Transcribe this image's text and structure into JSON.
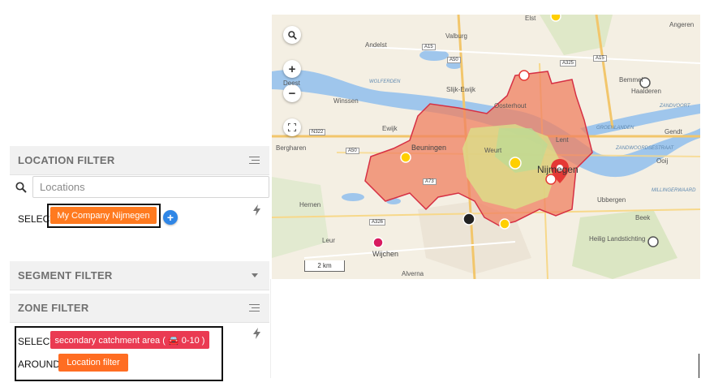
{
  "location_filter": {
    "title": "LOCATION FILTER",
    "search_placeholder": "Locations",
    "select_label": "SELECT",
    "selected_tag": "My Company Nijmegen",
    "add_button": "+"
  },
  "segment_filter": {
    "title": "SEGMENT FILTER"
  },
  "zone_filter": {
    "title": "ZONE FILTER",
    "select_label": "SELECT",
    "zone_tag": "secondary catchment area ( 🚘 0-10 )",
    "around_label": "AROUND",
    "around_tag": "Location filter"
  },
  "icons": {
    "menu": "lines-menu-icon",
    "caret": "chevron-down-icon",
    "bolt": "lightning-icon",
    "search": "search-icon"
  },
  "colors": {
    "location_tag": "#ff7a1f",
    "zone_tag": "#ea3a52",
    "around_tag": "#ff6d22",
    "plus_button": "#2f86e6",
    "catchment_fill": "#f08060",
    "catchment_border": "#d63044"
  },
  "map": {
    "scale": "2 km",
    "zoom_in": "+",
    "zoom_out": "−",
    "place_labels": {
      "nijmegen": "Nijmegen",
      "beuningen": "Beuningen",
      "wijchen": "Wijchen",
      "lent": "Lent",
      "weurt": "Weurt",
      "bemmel": "Bemmel",
      "elst": "Elst",
      "valburg": "Valburg",
      "andelst": "Andelst",
      "oosterhout": "Oosterhout",
      "slijk_ewijk": "Slijk-Ewijk",
      "winssen": "Winssen",
      "ewijk": "Ewijk",
      "bergharen": "Bergharen",
      "hernen": "Hernen",
      "leur": "Leur",
      "alverna": "Alverna",
      "ubbergen": "Ubbergen",
      "beek": "Beek",
      "heilig_landstichting": "Heilig Landstichting",
      "haalderen": "Haalderen",
      "gendt": "Gendt",
      "ooij": "Ooij",
      "deest": "Deest",
      "angeren": "Angeren"
    },
    "road_labels": [
      "A15",
      "A50",
      "A325",
      "N322",
      "A50",
      "A73",
      "A326",
      "A15"
    ],
    "water_labels": [
      "WOLFERDEN",
      "ZANDVOORT",
      "ZANDWOORDSESTRAAT",
      "GROENLANDEN",
      "MILLINGERWAARD"
    ]
  }
}
